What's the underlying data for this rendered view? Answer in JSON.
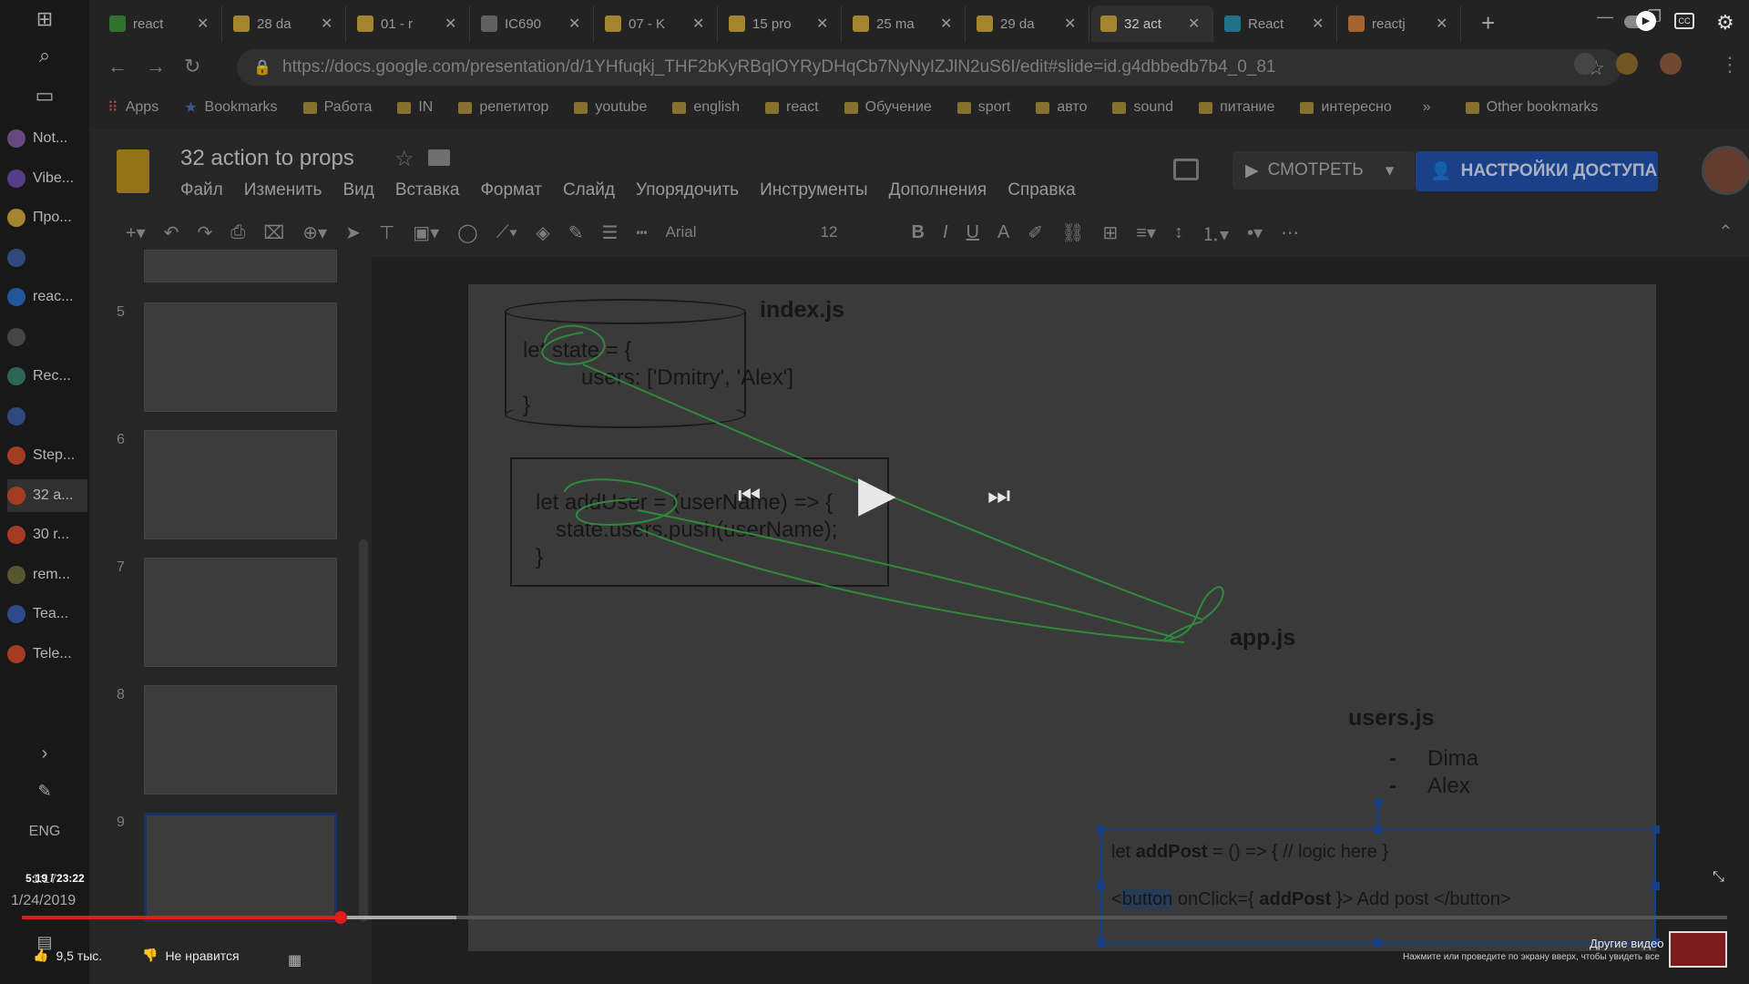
{
  "taskbar": {
    "apps": [
      {
        "label": "Not...",
        "color": "#7a5a9a"
      },
      {
        "label": "Vibe...",
        "color": "#6a4aa8"
      },
      {
        "label": "Про...",
        "color": "#c9a13a"
      },
      {
        "label": "",
        "color": "#3a5a9a"
      },
      {
        "label": "reac...",
        "color": "#2a6abf"
      },
      {
        "label": "",
        "color": "#555555"
      },
      {
        "label": "Rec...",
        "color": "#3a7a6a"
      },
      {
        "label": "",
        "color": "#3a5a9a"
      },
      {
        "label": "Step...",
        "color": "#c94a2a"
      },
      {
        "label": "32 a...",
        "color": "#c94a2a"
      },
      {
        "label": "30 r...",
        "color": "#c94a2a"
      },
      {
        "label": "rem...",
        "color": "#6a6a3a"
      },
      {
        "label": "Tea...",
        "color": "#3a5aaa"
      },
      {
        "label": "Tele...",
        "color": "#c94a2a"
      }
    ],
    "lang": "ENG",
    "time": "1:17",
    "date": "1/24/2019"
  },
  "tabs": [
    {
      "label": "react",
      "color": "#3a8a3a"
    },
    {
      "label": "28 da",
      "color": "#c9a13a"
    },
    {
      "label": "01 - r",
      "color": "#c9a13a"
    },
    {
      "label": "IC690",
      "color": "#777777"
    },
    {
      "label": "07 - K",
      "color": "#c9a13a"
    },
    {
      "label": "15 pro",
      "color": "#c9a13a"
    },
    {
      "label": "25 ma",
      "color": "#c9a13a"
    },
    {
      "label": "29 da",
      "color": "#c9a13a"
    },
    {
      "label": "32 act",
      "color": "#c9a13a",
      "active": true
    },
    {
      "label": "React",
      "color": "#2a8aaa"
    },
    {
      "label": "reactj",
      "color": "#c97a3a"
    }
  ],
  "address": {
    "url": "https://docs.google.com/presentation/d/1YHfuqkj_THF2bKyRBqlOYRyDHqCb7NyNyIZJlN2uS6I/edit#slide=id.g4dbbedb7b4_0_81"
  },
  "bookmarks": [
    {
      "label": "Apps",
      "type": "apps"
    },
    {
      "label": "Bookmarks",
      "type": "star"
    },
    {
      "label": "Работа",
      "type": "folder"
    },
    {
      "label": "IN",
      "type": "folder"
    },
    {
      "label": "репетитор",
      "type": "folder"
    },
    {
      "label": "youtube",
      "type": "folder"
    },
    {
      "label": "english",
      "type": "folder"
    },
    {
      "label": "react",
      "type": "folder"
    },
    {
      "label": "Обучение",
      "type": "folder"
    },
    {
      "label": "sport",
      "type": "folder"
    },
    {
      "label": "авто",
      "type": "folder"
    },
    {
      "label": "sound",
      "type": "folder"
    },
    {
      "label": "питание",
      "type": "folder"
    },
    {
      "label": "интересно",
      "type": "folder"
    }
  ],
  "bookmarks_more": "»",
  "bookmarks_other": "Other bookmarks",
  "doc": {
    "title": "32 action to props",
    "menu": [
      "Файл",
      "Изменить",
      "Вид",
      "Вставка",
      "Формат",
      "Слайд",
      "Упорядочить",
      "Инструменты",
      "Дополнения",
      "Справка"
    ],
    "present_label": "СМОТРЕТЬ",
    "share_label": "НАСТРОЙКИ ДОСТУПА",
    "font": "Arial",
    "font_size": "12"
  },
  "slides": [
    {
      "num": "5"
    },
    {
      "num": "6"
    },
    {
      "num": "7"
    },
    {
      "num": "8"
    },
    {
      "num": "9",
      "selected": true
    }
  ],
  "slide": {
    "index_label": "index.js",
    "state_code_1": "let state = {",
    "state_code_2": "users: ['Dmitry', 'Alex']",
    "state_code_3": "}",
    "adduser_1": "let addUser = (userName) => {",
    "adduser_2": "state.users.push(userName);",
    "adduser_3": "}",
    "app_label": "app.js",
    "users_label": "users.js",
    "users": [
      "Dima",
      "Alex"
    ],
    "addpost_pre": "let ",
    "addpost_bold": "addPost",
    "addpost_post": " = () => { // logic here }",
    "btn_pre": "<",
    "btn_hl": "button",
    "btn_mid": " onClick={ ",
    "btn_bold": "addPost",
    "btn_post": " }> Add post </button>"
  },
  "video": {
    "time": "5:19 / 23:22",
    "progress": 0.187,
    "buffered": 0.255,
    "likes": "9,5 тыс.",
    "dislike": "Не нравится",
    "other_videos": "Другие видео",
    "hint": "Нажмите или проведите по экрану вверх, чтобы увидеть все"
  },
  "colors": {
    "accent": "#1f4fa6",
    "progress": "#e21b1b",
    "annotation": "#3aa84a"
  }
}
